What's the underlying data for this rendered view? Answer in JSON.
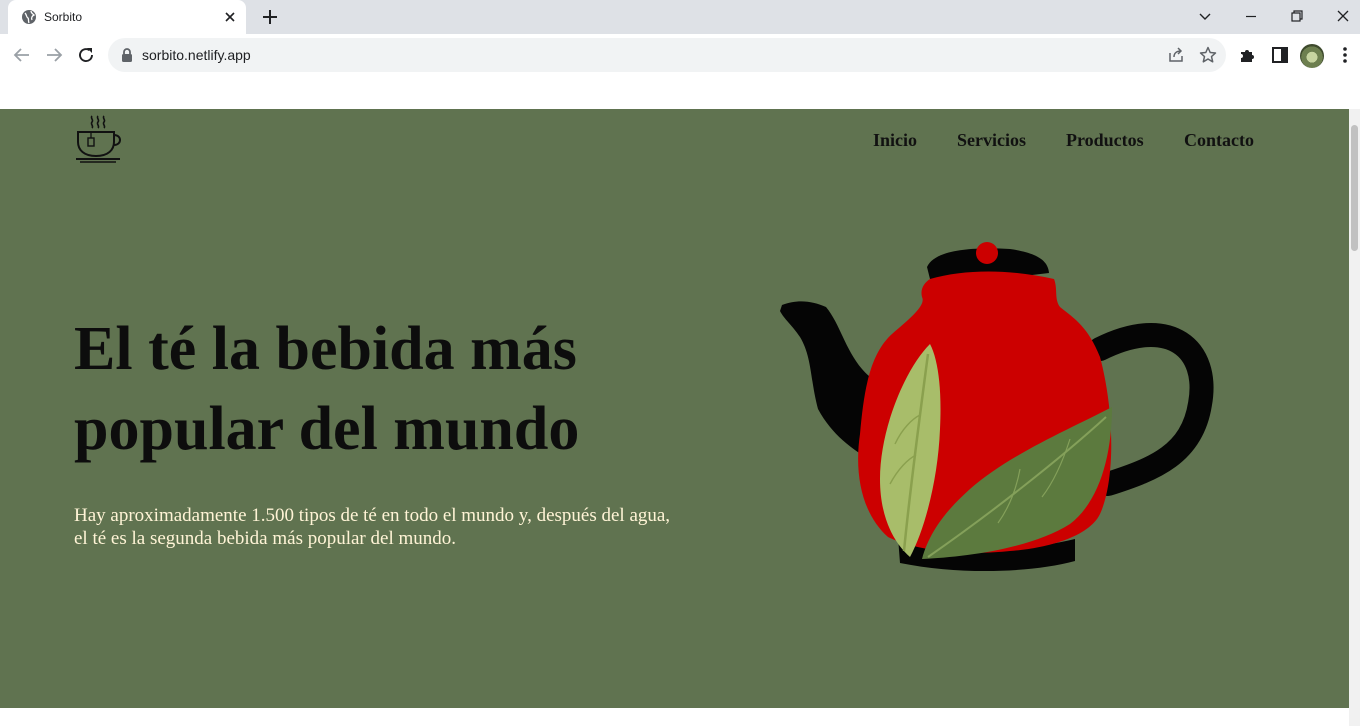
{
  "browser": {
    "tab_title": "Sorbito",
    "url": "sorbito.netlify.app"
  },
  "nav": {
    "items": [
      "Inicio",
      "Servicios",
      "Productos",
      "Contacto"
    ]
  },
  "hero": {
    "title": "El té la bebida más popular del mundo",
    "subtitle": "Hay aproximadamente 1.500 tipos de té en todo el mundo y, después del agua, el té es la segunda bebida más popular del mundo."
  },
  "colors": {
    "hero_bg": "#607350",
    "teapot_body": "#cc0000",
    "subtitle_text": "#fff4d6"
  },
  "icons": [
    "globe-icon",
    "close-icon",
    "plus-icon",
    "chevron-down-icon",
    "minimize-icon",
    "restore-icon",
    "close-window-icon",
    "back-arrow-icon",
    "forward-arrow-icon",
    "reload-icon",
    "lock-icon",
    "share-icon",
    "star-icon",
    "extensions-icon",
    "side-panel-icon",
    "kebab-menu-icon",
    "tea-cup-logo-icon"
  ]
}
